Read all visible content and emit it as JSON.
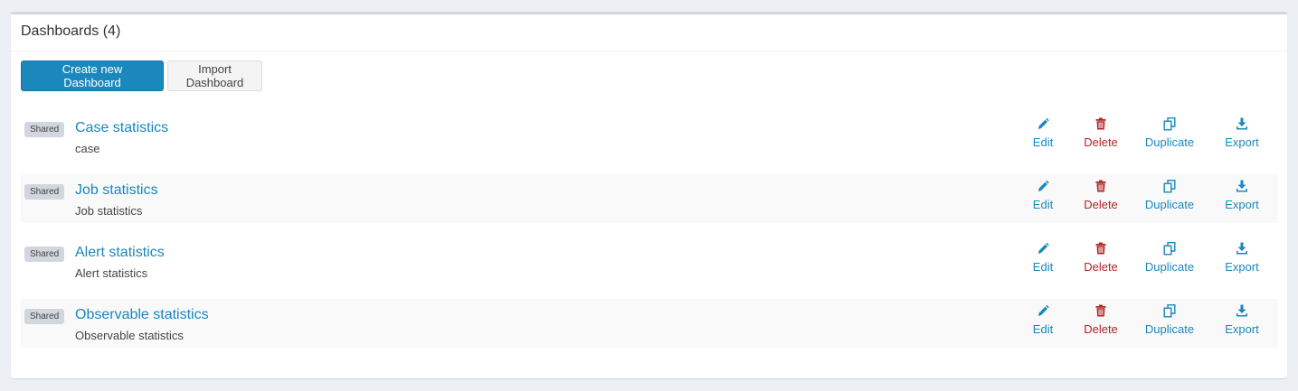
{
  "header": {
    "title": "Dashboards (4)"
  },
  "toolbar": {
    "create_label": "Create new Dashboard",
    "import_label": "Import Dashboard"
  },
  "actions": {
    "edit": "Edit",
    "delete": "Delete",
    "duplicate": "Duplicate",
    "export": "Export"
  },
  "icons": {
    "edit": "pencil-icon",
    "delete": "trash-icon",
    "duplicate": "copy-icon",
    "export": "download-icon"
  },
  "colors": {
    "primary": "#1a87bd",
    "danger": "#b32427",
    "badge": "#d2d6de"
  },
  "dashboards": [
    {
      "badge": "Shared",
      "title": "Case statistics",
      "description": "case"
    },
    {
      "badge": "Shared",
      "title": "Job statistics",
      "description": "Job statistics"
    },
    {
      "badge": "Shared",
      "title": "Alert statistics",
      "description": "Alert statistics"
    },
    {
      "badge": "Shared",
      "title": "Observable statistics",
      "description": "Observable statistics"
    }
  ]
}
